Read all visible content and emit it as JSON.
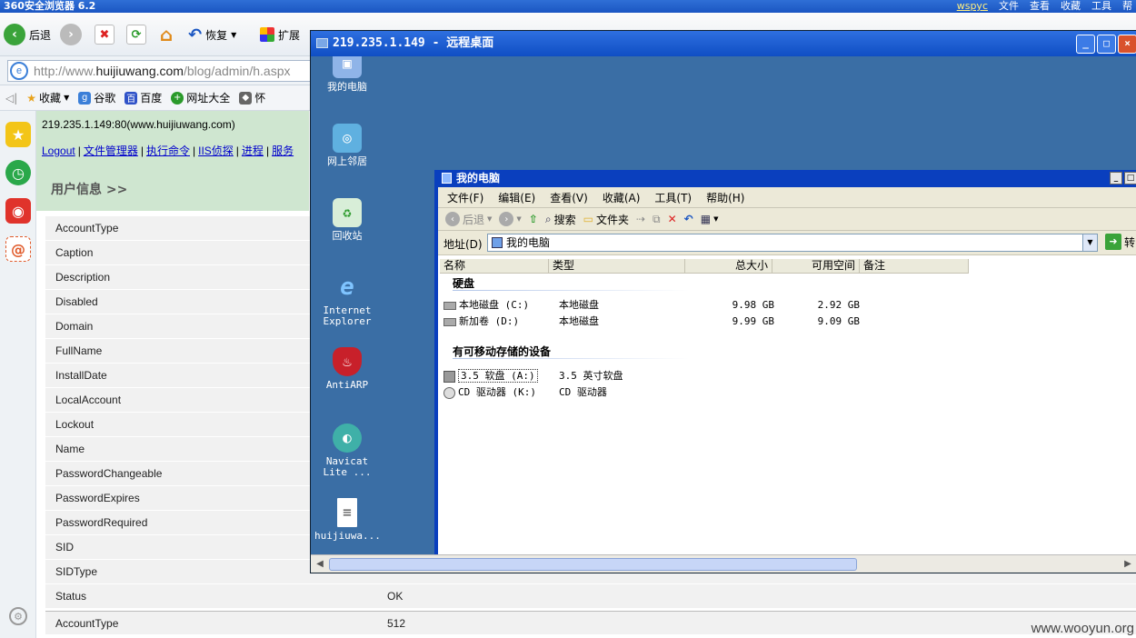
{
  "browser": {
    "title": "360安全浏览器 6.2",
    "menu": [
      "wspyc",
      "文件",
      "查看",
      "收藏",
      "工具",
      "帮"
    ],
    "toolbar": {
      "back": "后退",
      "restore": "恢复",
      "extensions": "扩展"
    },
    "address": {
      "url_prefix": "http://www.",
      "url_host": "huijiuwang.com",
      "url_path": "/blog/admin/h.aspx"
    },
    "favorites": [
      "收藏",
      "谷歌",
      "百度",
      "网址大全",
      "怀"
    ]
  },
  "page": {
    "url_line": "219.235.1.149:80(www.huijiuwang.com)",
    "links": [
      "Logout",
      "文件管理器",
      "执行命令",
      "IIS侦探",
      "进程",
      "服务"
    ],
    "section_title": "用户信息 >>",
    "rows": [
      {
        "key": "AccountType",
        "value": ""
      },
      {
        "key": "Caption",
        "value": ""
      },
      {
        "key": "Description",
        "value": ""
      },
      {
        "key": "Disabled",
        "value": ""
      },
      {
        "key": "Domain",
        "value": ""
      },
      {
        "key": "FullName",
        "value": ""
      },
      {
        "key": "InstallDate",
        "value": ""
      },
      {
        "key": "LocalAccount",
        "value": ""
      },
      {
        "key": "Lockout",
        "value": ""
      },
      {
        "key": "Name",
        "value": ""
      },
      {
        "key": "PasswordChangeable",
        "value": ""
      },
      {
        "key": "PasswordExpires",
        "value": ""
      },
      {
        "key": "PasswordRequired",
        "value": ""
      },
      {
        "key": "SID",
        "value": ""
      },
      {
        "key": "SIDType",
        "value": ""
      },
      {
        "key": "Status",
        "value": "OK"
      }
    ],
    "last_row": {
      "key": "AccountType",
      "value": "512"
    },
    "watermark": "www.wooyun.org"
  },
  "rdp": {
    "title": "219.235.1.149 - 远程桌面",
    "desktop_icons": [
      {
        "label": "我的电脑",
        "icon": "computer-icon"
      },
      {
        "label": "网上邻居",
        "icon": "network-icon"
      },
      {
        "label": "回收站",
        "icon": "recycle-bin-icon"
      },
      {
        "label": "Internet Explorer",
        "icon": "ie-icon"
      },
      {
        "label": "AntiARP",
        "icon": "antiarp-icon"
      },
      {
        "label": "Navicat Lite ...",
        "icon": "navicat-icon"
      },
      {
        "label": "huijiuwa...",
        "icon": "text-file-icon"
      }
    ]
  },
  "explorer": {
    "title": "我的电脑",
    "menu": [
      "文件(F)",
      "编辑(E)",
      "查看(V)",
      "收藏(A)",
      "工具(T)",
      "帮助(H)"
    ],
    "toolbar": {
      "back": "后退",
      "search": "搜索",
      "folders": "文件夹"
    },
    "address_label": "地址(D)",
    "address_value": "我的电脑",
    "go_label": "转",
    "columns": [
      "名称",
      "类型",
      "总大小",
      "可用空间",
      "备注"
    ],
    "group_hdd": "硬盘",
    "drives": [
      {
        "name": "本地磁盘 (C:)",
        "type": "本地磁盘",
        "total": "9.98 GB",
        "free": "2.92 GB"
      },
      {
        "name": "新加卷 (D:)",
        "type": "本地磁盘",
        "total": "9.99 GB",
        "free": "9.09 GB"
      }
    ],
    "group_removable": "有可移动存储的设备",
    "removable": [
      {
        "name": "3.5 软盘 (A:)",
        "type": "3.5 英寸软盘"
      },
      {
        "name": "CD 驱动器 (K:)",
        "type": "CD 驱动器"
      }
    ]
  }
}
